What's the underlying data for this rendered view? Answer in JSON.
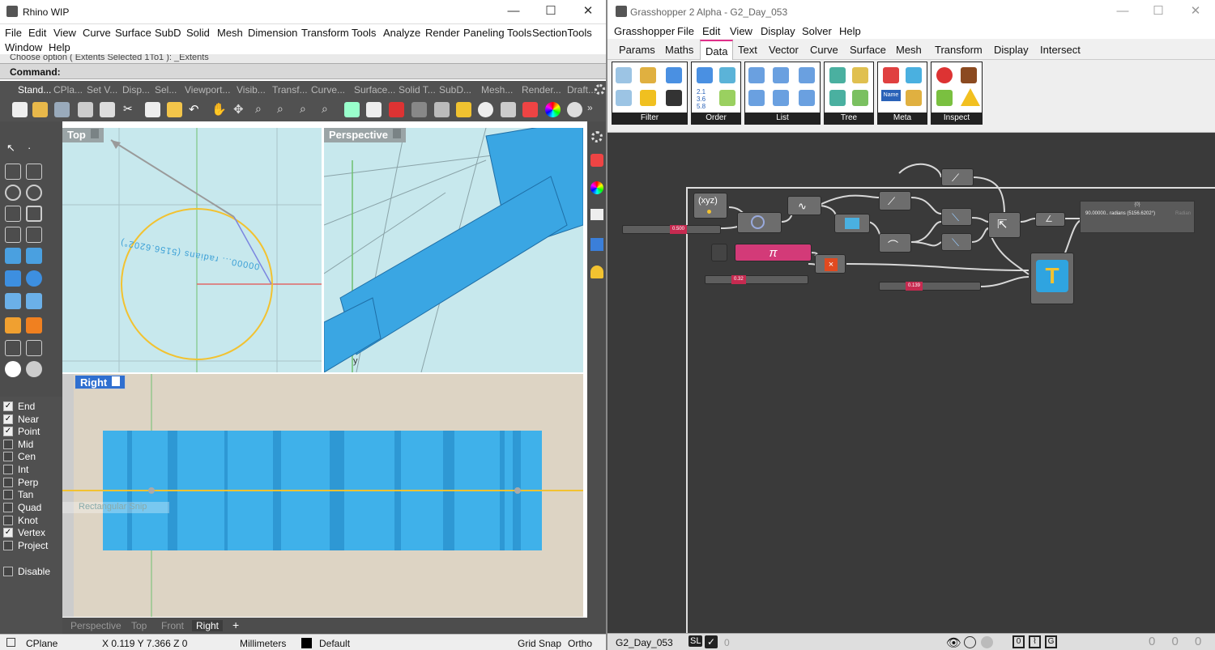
{
  "rhino": {
    "title": "Rhino WIP",
    "menu": [
      "File",
      "Edit",
      "View",
      "Curve",
      "Surface",
      "SubD",
      "Solid",
      "Mesh",
      "Dimension",
      "Transform",
      "Tools",
      "Analyze",
      "Render",
      "Paneling Tools",
      "SectionTools",
      "Window",
      "Help"
    ],
    "command_history": "Choose option ( Extents  Selected  1To1 ): _Extents",
    "command_label": "Command:",
    "toolbar_tabs": [
      "Stand...",
      "CPla...",
      "Set V...",
      "Disp...",
      "Sel...",
      "Viewport...",
      "Visib...",
      "Transf...",
      "Curve...",
      "Surface...",
      "Solid T...",
      "SubD...",
      "Mesh...",
      "Render...",
      "Draft..."
    ],
    "viewports": {
      "top": "Top",
      "perspective": "Perspective",
      "right": "Right",
      "right_hint": "Rectangular Snip",
      "axis_y": "y"
    },
    "osnaps": [
      {
        "label": "End",
        "checked": true
      },
      {
        "label": "Near",
        "checked": true
      },
      {
        "label": "Point",
        "checked": true
      },
      {
        "label": "Mid",
        "checked": false
      },
      {
        "label": "Cen",
        "checked": false
      },
      {
        "label": "Int",
        "checked": false
      },
      {
        "label": "Perp",
        "checked": false
      },
      {
        "label": "Tan",
        "checked": false
      },
      {
        "label": "Quad",
        "checked": false
      },
      {
        "label": "Knot",
        "checked": false
      },
      {
        "label": "Vertex",
        "checked": true
      },
      {
        "label": "Project",
        "checked": false
      }
    ],
    "disable_label": "Disable",
    "viewport_tabs": [
      "Perspective",
      "Top",
      "Front",
      "Right"
    ],
    "add_tab": "+",
    "top_view_text": "00000... radians (5156.6202°)",
    "status": {
      "cplane": "CPlane",
      "coords": "X 0.119  Y 7.366  Z 0",
      "units": "Millimeters",
      "layer": "Default",
      "grid_snap": "Grid Snap",
      "ortho": "Ortho"
    }
  },
  "grasshopper": {
    "title": "Grasshopper 2 Alpha - G2_Day_053",
    "menu": [
      "Grasshopper",
      "File",
      "Edit",
      "View",
      "Display",
      "Solver",
      "Help"
    ],
    "tabs": [
      "Params",
      "Maths",
      "Data",
      "Text",
      "Vector",
      "Curve",
      "Surface",
      "Mesh",
      "Transform",
      "Display",
      "Intersect"
    ],
    "active_tab": "Data",
    "groups": [
      "Filter",
      "Order",
      "List",
      "Tree",
      "Meta",
      "Inspect"
    ],
    "order_numbers": "2.1\n3.6\n5.8",
    "meta_name": "Name",
    "components": {
      "xyz": "(xyz)",
      "pi": "π",
      "multiply": "×",
      "panel_header": "{0}",
      "panel_text": "90.00000.. radians (5156.6202°)",
      "panel_type": "Radian"
    },
    "sliders": [
      "0.500",
      "0.32",
      "0.139"
    ],
    "status": {
      "file": "G2_Day_053",
      "sl": "SL",
      "count": "0",
      "right": "0  0  0"
    }
  }
}
